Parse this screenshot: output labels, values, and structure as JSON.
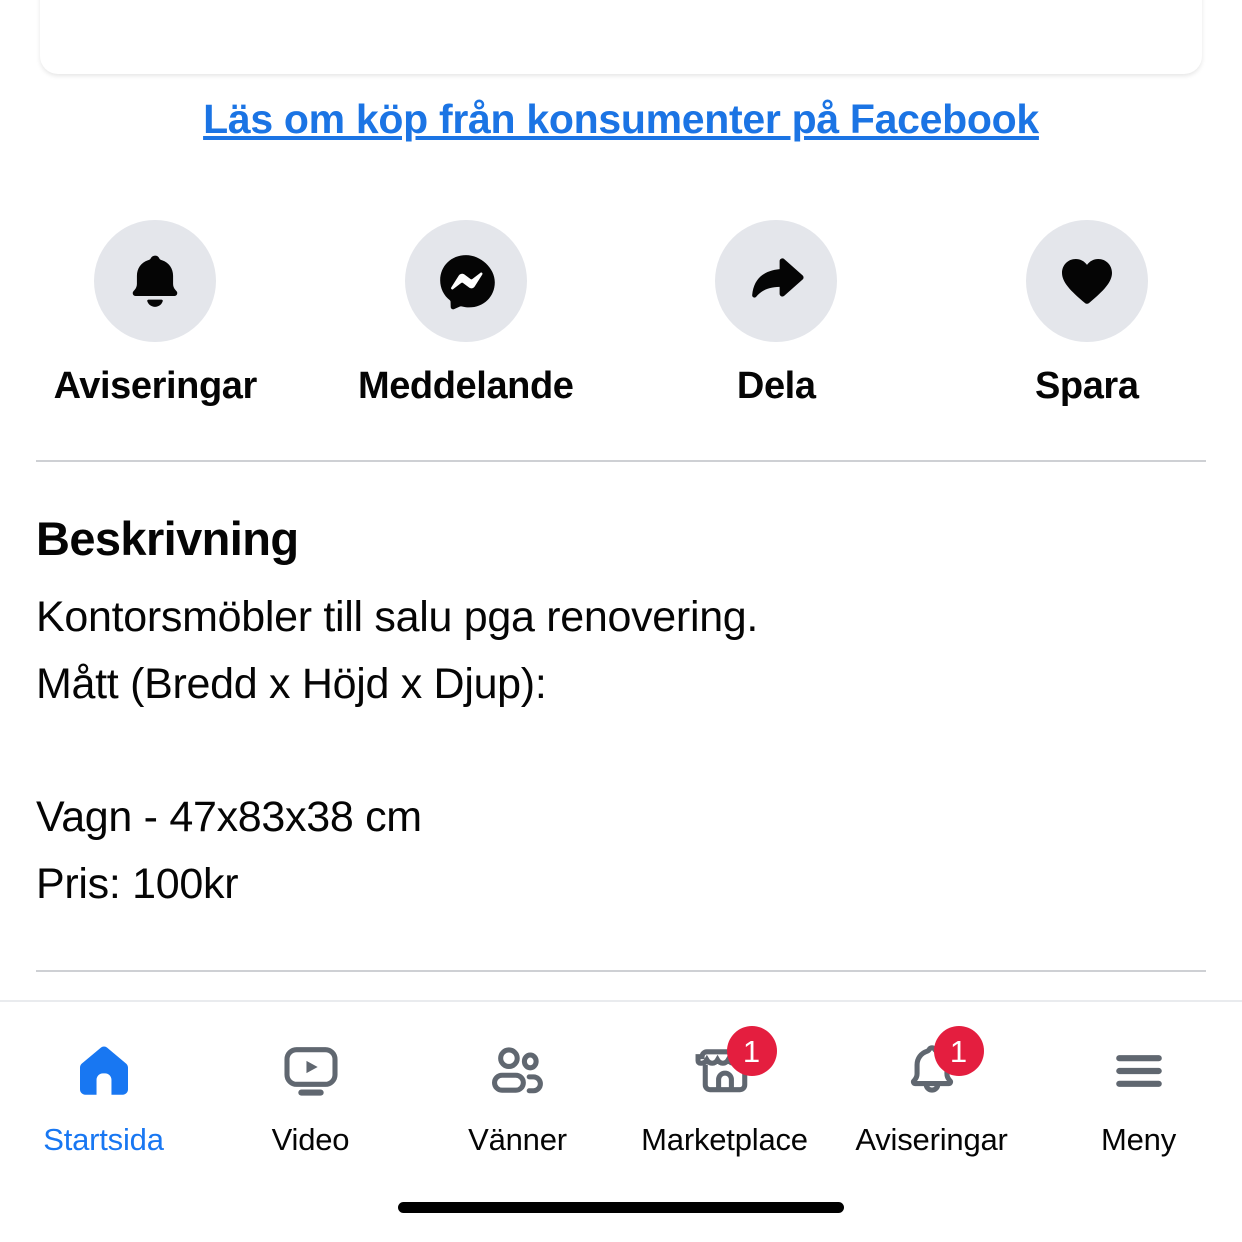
{
  "top_card": {
    "button_label": ""
  },
  "link": {
    "text": "Läs om köp från konsumenter på Facebook",
    "color": "#1b74e4"
  },
  "actions": [
    {
      "label": "Aviseringar",
      "icon": "bell-filled-icon"
    },
    {
      "label": "Meddelande",
      "icon": "messenger-icon"
    },
    {
      "label": "Dela",
      "icon": "share-arrow-icon"
    },
    {
      "label": "Spara",
      "icon": "heart-filled-icon"
    }
  ],
  "description": {
    "title": "Beskrivning",
    "body": "Kontorsmöbler till salu pga renovering.\nMått (Bredd x Höjd x Djup):\n\nVagn - 47x83x38 cm\nPris: 100kr"
  },
  "bottom_nav": {
    "active_index": 0,
    "accent_color": "#1877f2",
    "badge_color": "#e41e3f",
    "items": [
      {
        "label": "Startsida",
        "icon": "home-icon",
        "active": true,
        "badge": ""
      },
      {
        "label": "Video",
        "icon": "video-icon",
        "active": false,
        "badge": ""
      },
      {
        "label": "Vänner",
        "icon": "friends-icon",
        "active": false,
        "badge": ""
      },
      {
        "label": "Marketplace",
        "icon": "marketplace-icon",
        "active": false,
        "badge": "1"
      },
      {
        "label": "Aviseringar",
        "icon": "bell-outline-icon",
        "active": false,
        "badge": "1"
      },
      {
        "label": "Meny",
        "icon": "hamburger-menu-icon",
        "active": false,
        "badge": ""
      }
    ]
  }
}
